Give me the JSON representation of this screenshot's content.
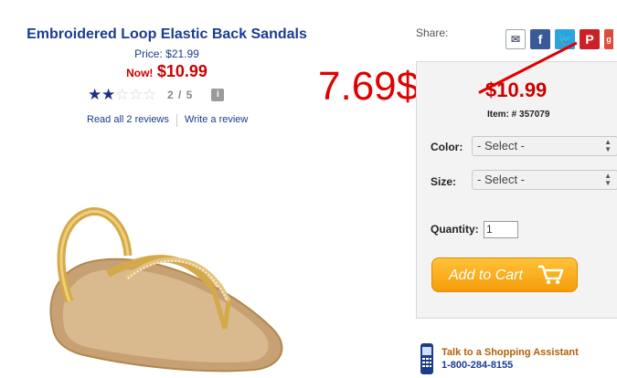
{
  "product": {
    "title": "Embroidered Loop Elastic Back Sandals",
    "price_line": "Price: $21.99",
    "now_label": "Now!",
    "now_price": "$10.99",
    "rating_score": "2 / 5",
    "rating_value": 2,
    "rating_max": 5,
    "info_icon": "i",
    "read_reviews": "Read all 2 reviews",
    "write_review": "Write a review"
  },
  "annotation": {
    "new_price": "7.69$",
    "color": "#e00000"
  },
  "share": {
    "label": "Share:",
    "icons": [
      "email-icon",
      "facebook-icon",
      "twitter-icon",
      "pinterest-icon",
      "google-plus-icon"
    ],
    "fb_glyph": "f",
    "pin_glyph": "P",
    "gp_glyph": "g"
  },
  "buy_box": {
    "price": "$10.99",
    "item_number": "Item: # 357079",
    "color_label": "Color:",
    "color_value": "- Select -",
    "size_label": "Size:",
    "size_value": "- Select -",
    "quantity_label": "Quantity:",
    "quantity_value": "1",
    "add_to_cart": "Add to Cart"
  },
  "assistant": {
    "title": "Talk to a Shopping Assistant",
    "phone": "1-800-284-8155"
  },
  "colors": {
    "brand_blue": "#1b3c8e",
    "sale_red": "#cc0000",
    "cart_orange": "#f59d0a"
  }
}
